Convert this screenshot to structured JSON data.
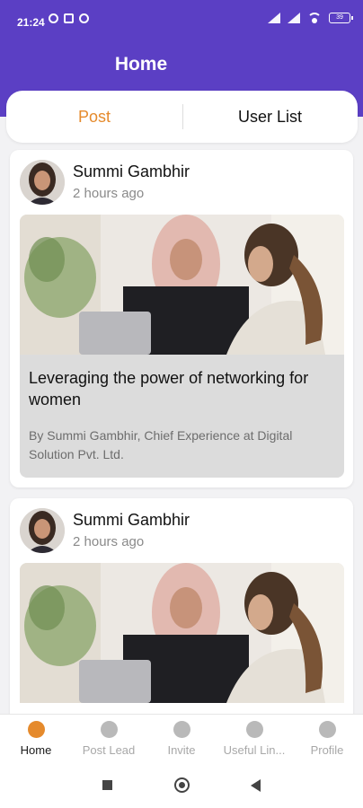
{
  "status_bar": {
    "time": "21:24",
    "battery": "39"
  },
  "header": {
    "title": "Home"
  },
  "tabs": [
    {
      "label": "Post",
      "active": true
    },
    {
      "label": "User List",
      "active": false
    }
  ],
  "posts": [
    {
      "author": "Summi Gambhir",
      "time": "2 hours ago",
      "title": "Leveraging the power of networking for women",
      "subtitle": "By Summi Gambhir, Chief Experience at Digital Solution Pvt. Ltd."
    },
    {
      "author": "Summi Gambhir",
      "time": "2 hours ago"
    }
  ],
  "bottom_nav": [
    {
      "label": "Home",
      "active": true
    },
    {
      "label": "Post Lead",
      "active": false
    },
    {
      "label": "Invite",
      "active": false
    },
    {
      "label": "Useful Lin...",
      "active": false
    },
    {
      "label": "Profile",
      "active": false
    }
  ],
  "colors": {
    "brand": "#5b3fc4",
    "accent": "#e58a2c"
  }
}
